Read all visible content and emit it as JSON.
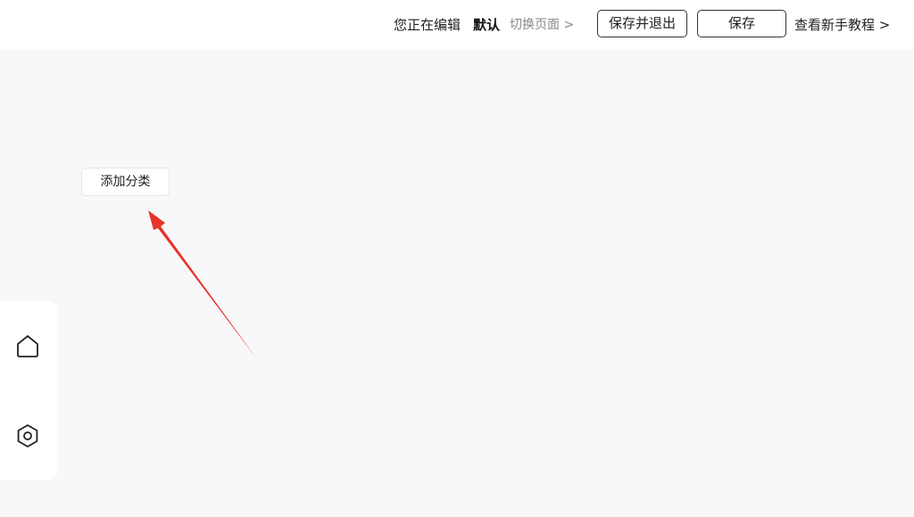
{
  "header": {
    "editing_label": "您正在编辑",
    "editing_name": "默认",
    "switch_page": "切换页面 >",
    "save_exit_label": "保存并退出",
    "save_label": "保存",
    "tutorial_label": "查看新手教程 >"
  },
  "canvas": {
    "add_category_label": "添加分类",
    "annotation_arrow_color": "#e8332a"
  },
  "sidebar": {
    "items": [
      {
        "icon": "home-icon"
      },
      {
        "icon": "settings-icon"
      }
    ]
  }
}
